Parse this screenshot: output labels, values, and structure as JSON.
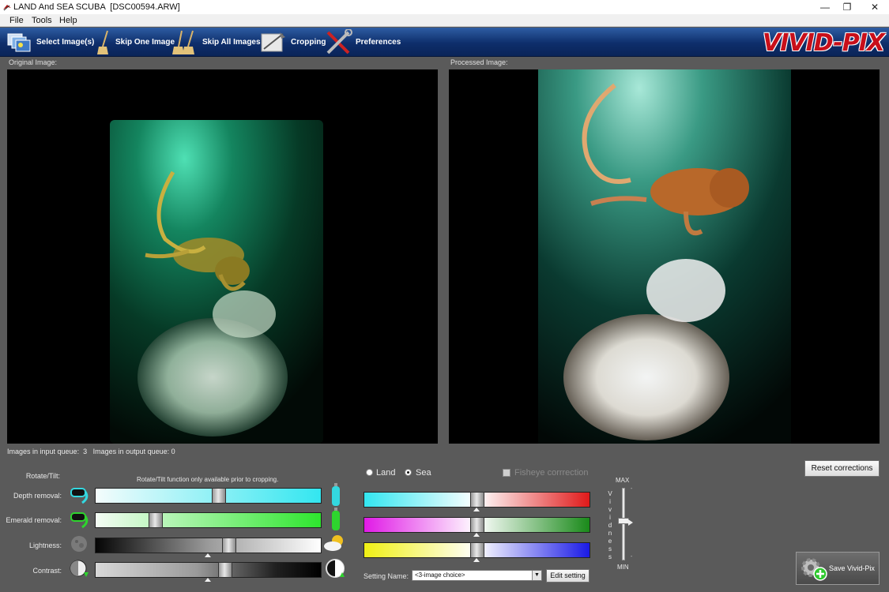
{
  "window": {
    "title": "LAND And SEA SCUBA  [DSC00594.ARW]",
    "minimize": "—",
    "restore": "❐",
    "close": "✕"
  },
  "menu": [
    "File",
    "Tools",
    "Help"
  ],
  "toolbar": {
    "select_images": "Select Image(s)",
    "skip_one": "Skip One Image",
    "skip_all": "Skip All Images",
    "cropping": "Cropping",
    "preferences": "Preferences",
    "logo": "VIVID-PIX"
  },
  "panels": {
    "original_label": "Original Image:",
    "processed_label": "Processed Image:"
  },
  "queue": {
    "text": "Images in input queue:  3   Images in output queue: 0"
  },
  "controls": {
    "rotate_label": "Rotate/Tilt:",
    "rotate_note": "Rotate/Tilt function only available prior to cropping.",
    "depth_label": "Depth removal:",
    "emerald_label": "Emerald removal:",
    "lightness_label": "Lightness:",
    "contrast_label": "Contrast:",
    "depth_value": 0.55,
    "emerald_value": 0.25,
    "lightness_value": 0.6,
    "contrast_value": 0.58
  },
  "mode": {
    "land": "Land",
    "sea": "Sea",
    "selected": "Sea",
    "fisheye": "Fisheye corrrection"
  },
  "color_sliders": {
    "cyan_red": 0.5,
    "magenta_green": 0.5,
    "yellow_blue": 0.5
  },
  "setting": {
    "label": "Setting Name:",
    "value": "<3-image choice>",
    "edit": "Edit setting"
  },
  "vividness": {
    "max": "MAX",
    "min": "MIN",
    "letters": [
      "V",
      "i",
      "v",
      "i",
      "d",
      "n",
      "e",
      "s",
      "s"
    ],
    "value": 0.55
  },
  "buttons": {
    "reset": "Reset corrections",
    "save": "Save Vivid-Pix"
  },
  "colors": {
    "toolbar": "#0e2e6b",
    "logo_red": "#c80f1a",
    "cyan": "#33e6f0",
    "emerald": "#2ee62e",
    "red": "#e01a1a",
    "magenta": "#e01ae6",
    "green": "#1a8a1a",
    "yellow": "#f0f014",
    "blue": "#1a1ae6"
  }
}
